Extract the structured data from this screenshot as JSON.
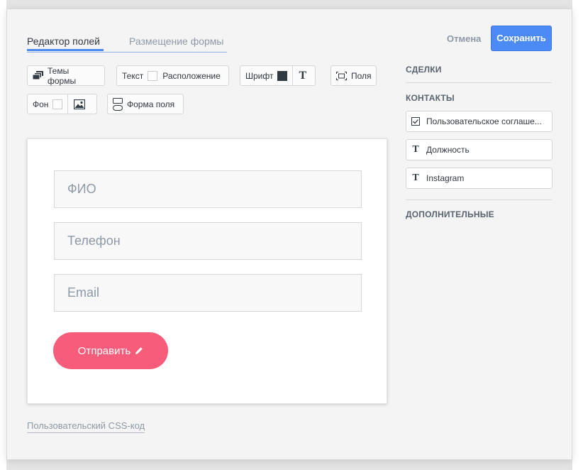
{
  "tabs": {
    "editor": "Редактор полей",
    "placement": "Размещение формы"
  },
  "actions": {
    "cancel": "Отмена",
    "save": "Сохранить"
  },
  "toolbar": {
    "themes": "Темы формы",
    "text": "Текст",
    "location": "Расположение",
    "font": "Шрифт",
    "font_color": "#313942",
    "fields": "Поля",
    "background": "Фон",
    "field_shape": "Форма поля"
  },
  "form": {
    "fields": [
      {
        "placeholder": "ФИО"
      },
      {
        "placeholder": "Телефон"
      },
      {
        "placeholder": "Email"
      }
    ],
    "submit_label": "Отправить",
    "submit_color": "#f85c7b"
  },
  "custom_css_link": "Пользовательский CSS-код",
  "sidebar": {
    "sections": {
      "deals": "СДЕЛКИ",
      "contacts": "КОНТАКТЫ",
      "additional": "ДОПОЛНИТЕЛЬНЫЕ"
    },
    "contact_items": [
      {
        "label": "Пользовательское соглаше...",
        "icon": "checkbox-icon"
      },
      {
        "label": "Должность",
        "icon": "text-icon"
      },
      {
        "label": "Instagram",
        "icon": "text-icon"
      }
    ]
  },
  "colors": {
    "accent": "#4c8bf5",
    "modal_bg": "#f4f4f4"
  }
}
